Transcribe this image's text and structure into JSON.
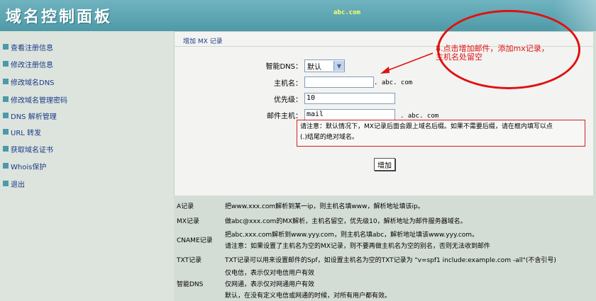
{
  "header": {
    "logo": "域名控制面板",
    "domain": "abc.com"
  },
  "sidebar": {
    "items": [
      {
        "label": "查看注册信息"
      },
      {
        "label": "修改注册信息"
      },
      {
        "label": "修改域名DNS"
      },
      {
        "label": "修改域名管理密码"
      },
      {
        "label": "DNS 解析管理"
      },
      {
        "label": "URL 转发"
      },
      {
        "label": "获取域名证书"
      },
      {
        "label": "Whois保护"
      },
      {
        "label": "退出"
      }
    ]
  },
  "form": {
    "section_title": "增加 MX 记录",
    "smart_dns_label": "智能DNS：",
    "smart_dns_value": "默认",
    "host_label": "主机名：",
    "host_value": "",
    "host_suffix": ". abc. com",
    "priority_label": "优先级：",
    "priority_value": "10",
    "mail_host_label": "邮件主机：",
    "mail_host_value": "mail",
    "mail_host_suffix": ". abc. com",
    "note_line1": "请注意：默认情况下，MX记录后面会跟上域名后缀。如果不需要后缀，请在框内填写以点",
    "note_line2": "(.)结尾的绝对域名。",
    "add_button": "增加"
  },
  "annotation": {
    "line1": "8.点击增加邮件，添加mx记录，",
    "line2": "主机名处留空",
    "color": "#e01010"
  },
  "help": [
    {
      "label": "A记录",
      "lines": [
        "把www.xxx.com解析到某一ip，则主机名填www，解析地址填该ip。"
      ]
    },
    {
      "label": "MX记录",
      "lines": [
        "做abc@xxx.com的MX解析，主机名留空，优先级10，解析地址为邮件服务器域名。"
      ]
    },
    {
      "label": "CNAME记录",
      "lines": [
        "把abc.xxx.com解析到www.yyy.com，则主机名填abc，解析地址填该www.yyy.com。",
        "请注意：如果设置了主机名为空的MX记录，则不要再做主机名为空的别名，否则无法收到邮件"
      ]
    },
    {
      "label": "TXT记录",
      "lines": [
        "TXT记录可以用来设置邮件的Spf，如设置主机名为空的TXT记录为 \"v=spf1 include:example.com -all\"(不含引号)"
      ]
    },
    {
      "label": "智能DNS",
      "lines": [
        "仅电信，表示仅对电信用户有效",
        "仅网通，表示仅对网通用户有效",
        "默认，在没有定义电信或网通的时候，对所有用户都有效。"
      ]
    }
  ]
}
